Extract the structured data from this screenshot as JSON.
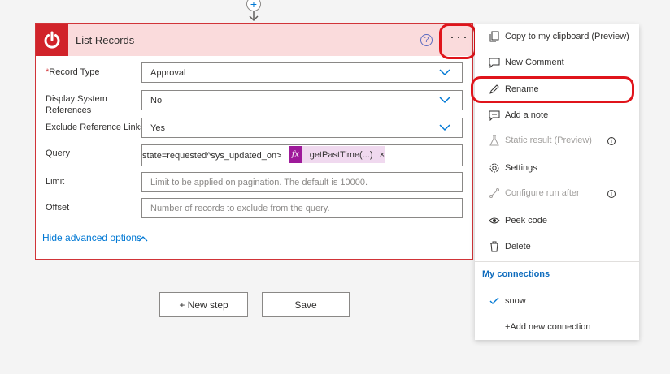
{
  "connector": {
    "plus": "+"
  },
  "card": {
    "title": "List Records",
    "help": "?",
    "more": "···",
    "fields": {
      "record_type": {
        "required": "*",
        "label": "Record Type",
        "value": "Approval"
      },
      "display_system_references": {
        "label": "Display System References",
        "value": "No"
      },
      "exclude_reference_links": {
        "label": "Exclude Reference Links",
        "value": "Yes"
      },
      "query": {
        "label": "Query",
        "value": "state=requested^sys_updated_on>",
        "token_fx": "fx",
        "token_label": "getPastTime(...)",
        "token_close": "×"
      },
      "limit": {
        "label": "Limit",
        "placeholder": "Limit to be applied on pagination. The default is 10000."
      },
      "offset": {
        "label": "Offset",
        "placeholder": "Number of records to exclude from the query."
      }
    },
    "hide_advanced": "Hide advanced options"
  },
  "actions": {
    "new_step": "+ New step",
    "save": "Save"
  },
  "menu": {
    "items": [
      {
        "label": "Copy to my clipboard (Preview)",
        "icon": "copy-icon",
        "disabled": false
      },
      {
        "label": "New Comment",
        "icon": "comment-icon",
        "disabled": false
      },
      {
        "label": "Rename",
        "icon": "pencil-icon",
        "disabled": false
      },
      {
        "label": "Add a note",
        "icon": "note-icon",
        "disabled": false
      },
      {
        "label": "Static result (Preview)",
        "icon": "flask-icon",
        "disabled": true
      },
      {
        "label": "Settings",
        "icon": "gear-icon",
        "disabled": false
      },
      {
        "label": "Configure run after",
        "icon": "run-after-icon",
        "disabled": true
      },
      {
        "label": "Peek code",
        "icon": "eye-icon",
        "disabled": false
      },
      {
        "label": "Delete",
        "icon": "trash-icon",
        "disabled": false
      }
    ],
    "section_title": "My connections",
    "connections": [
      {
        "label": "snow",
        "selected": true
      },
      {
        "label": "+Add new connection",
        "selected": false
      }
    ]
  },
  "colors": {
    "accent": "#0078d4",
    "brand_red": "#d1232a",
    "highlight": "#e0141b",
    "header_bg": "#fadbdc"
  }
}
